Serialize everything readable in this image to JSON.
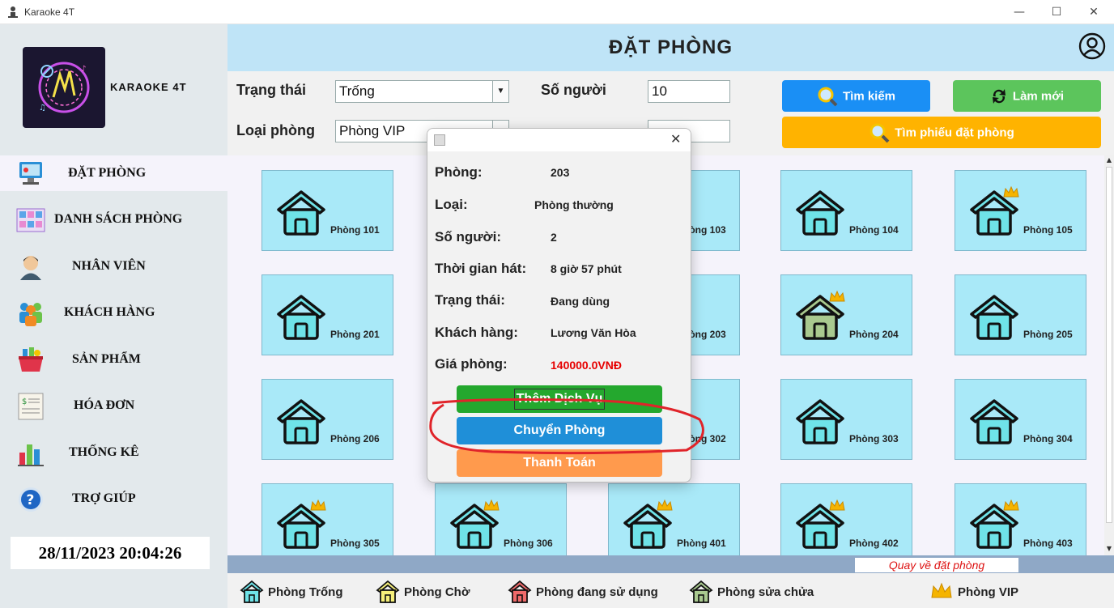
{
  "window": {
    "title": "Karaoke 4T"
  },
  "sidebar": {
    "brand": "KARAOKE 4T",
    "items": [
      {
        "label": "ĐẶT PHÒNG",
        "icon": "booking-computer-icon"
      },
      {
        "label": "DANH SÁCH PHÒNG",
        "icon": "room-list-icon"
      },
      {
        "label": "NHÂN VIÊN",
        "icon": "employee-icon"
      },
      {
        "label": "KHÁCH HÀNG",
        "icon": "customers-icon"
      },
      {
        "label": "SẢN PHẨM",
        "icon": "products-basket-icon"
      },
      {
        "label": "HÓA ĐƠN",
        "icon": "invoice-icon"
      },
      {
        "label": "THỐNG KÊ",
        "icon": "statistics-chart-icon"
      },
      {
        "label": "TRỢ GIÚP",
        "icon": "help-icon"
      }
    ],
    "clock": "28/11/2023 20:04:26"
  },
  "header": {
    "title": "ĐẶT PHÒNG"
  },
  "filter": {
    "status_label": "Trạng thái",
    "status_value": "Trống",
    "type_label": "Loại phòng",
    "type_value": "Phòng VIP",
    "people_label": "Số người",
    "people_value": "10",
    "search_label": "Tìm kiếm",
    "refresh_label": "Làm mới",
    "find_ticket_label": "Tìm phiếu đặt phòng"
  },
  "rooms": [
    {
      "name": "Phòng 101",
      "state": "empty",
      "vip": false
    },
    {
      "name": "Phòng 103",
      "state": "empty",
      "vip": false
    },
    {
      "name": "Phòng 104",
      "state": "empty",
      "vip": false
    },
    {
      "name": "Phòng 105",
      "state": "empty",
      "vip": true
    },
    {
      "name": "Phòng 201",
      "state": "empty",
      "vip": false
    },
    {
      "name": "Phòng 203",
      "state": "empty",
      "vip": false
    },
    {
      "name": "Phòng 204",
      "state": "repair",
      "vip": true
    },
    {
      "name": "Phòng 205",
      "state": "empty",
      "vip": false
    },
    {
      "name": "Phòng 206",
      "state": "empty",
      "vip": false
    },
    {
      "name": "Phòng 302",
      "state": "empty",
      "vip": false
    },
    {
      "name": "Phòng 303",
      "state": "empty",
      "vip": false
    },
    {
      "name": "Phòng 304",
      "state": "empty",
      "vip": false
    },
    {
      "name": "Phòng 305",
      "state": "empty",
      "vip": true
    },
    {
      "name": "Phòng 306",
      "state": "empty",
      "vip": true
    },
    {
      "name": "Phòng 401",
      "state": "empty",
      "vip": true
    },
    {
      "name": "Phòng 402",
      "state": "empty",
      "vip": true
    },
    {
      "name": "Phòng 403",
      "state": "empty",
      "vip": true
    }
  ],
  "status_bar": {
    "back_link": "Quay về đặt phòng"
  },
  "legend": {
    "empty": "Phòng Trống",
    "waiting": "Phòng Chờ",
    "in_use": "Phòng đang sử dụng",
    "repair": "Phòng sửa chửa",
    "vip": "Phòng VIP"
  },
  "dialog": {
    "room_label": "Phòng:",
    "room_value": "203",
    "type_label": "Loại:",
    "type_value": "Phòng thường",
    "people_label": "Số người:",
    "people_value": "2",
    "time_label": "Thời gian hát:",
    "time_value": "8 giờ 57 phút",
    "status_label": "Trạng thái:",
    "status_value": "Đang dùng",
    "customer_label": "Khách hàng:",
    "customer_value": "Lương Văn Hòa",
    "price_label": "Giá phòng:",
    "price_value": "140000.0VNĐ",
    "add_service": "Thêm Dịch Vụ",
    "move_room": "Chuyển Phòng",
    "pay": "Thanh Toán"
  },
  "colors": {
    "room_empty": "#a9e9f8",
    "house_empty": "#6fe3e8",
    "house_repair": "#a9c98f",
    "price_text": "#e60000",
    "btn_search": "#1a8ff5",
    "btn_refresh": "#5cc55c",
    "btn_find_ticket": "#ffb300",
    "btn_add_service": "#24a82e",
    "btn_move_room": "#1f8fd8",
    "btn_pay": "#ff9a4d"
  }
}
